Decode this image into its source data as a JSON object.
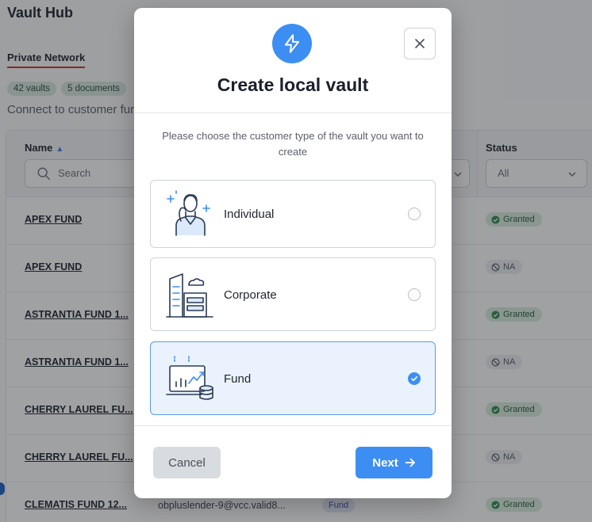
{
  "app": {
    "title": "Vault Hub",
    "tab": "Private Network",
    "chips": [
      "42 vaults",
      "5 documents"
    ],
    "subtitle": "Connect to customer funds"
  },
  "table": {
    "columns": {
      "name": "Name",
      "status": "Status"
    },
    "search_placeholder": "Search",
    "status_filter": "All",
    "rows": [
      {
        "name": "APEX FUND",
        "email": "",
        "type": "",
        "status": "Granted"
      },
      {
        "name": "APEX FUND",
        "email": "",
        "type": "",
        "status": "NA"
      },
      {
        "name": "ASTRANTIA FUND 1...",
        "email": "",
        "type": "",
        "status": "Granted"
      },
      {
        "name": "ASTRANTIA FUND 1...",
        "email": "",
        "type": "",
        "status": "NA"
      },
      {
        "name": "CHERRY LAUREL FU...",
        "email": "",
        "type": "",
        "status": "Granted"
      },
      {
        "name": "CHERRY LAUREL FU...",
        "email": "",
        "type": "",
        "status": "NA"
      },
      {
        "name": "CLEMATIS FUND 12...",
        "email": "obpluslender-9@vcc.valid8...",
        "type": "Fund",
        "status": "Granted"
      }
    ]
  },
  "modal": {
    "title": "Create local vault",
    "instruction": "Please choose the customer type of the vault you want to create",
    "options": [
      {
        "label": "Individual",
        "icon": "individual-illustration-icon",
        "selected": false
      },
      {
        "label": "Corporate",
        "icon": "corporate-illustration-icon",
        "selected": false
      },
      {
        "label": "Fund",
        "icon": "fund-illustration-icon",
        "selected": true
      }
    ],
    "cancel_label": "Cancel",
    "next_label": "Next"
  },
  "colors": {
    "accent": "#3d8ef2",
    "granted_bg": "#d9ecdf",
    "na_bg": "#eceef1",
    "selected_bg": "#eaf3fd"
  }
}
